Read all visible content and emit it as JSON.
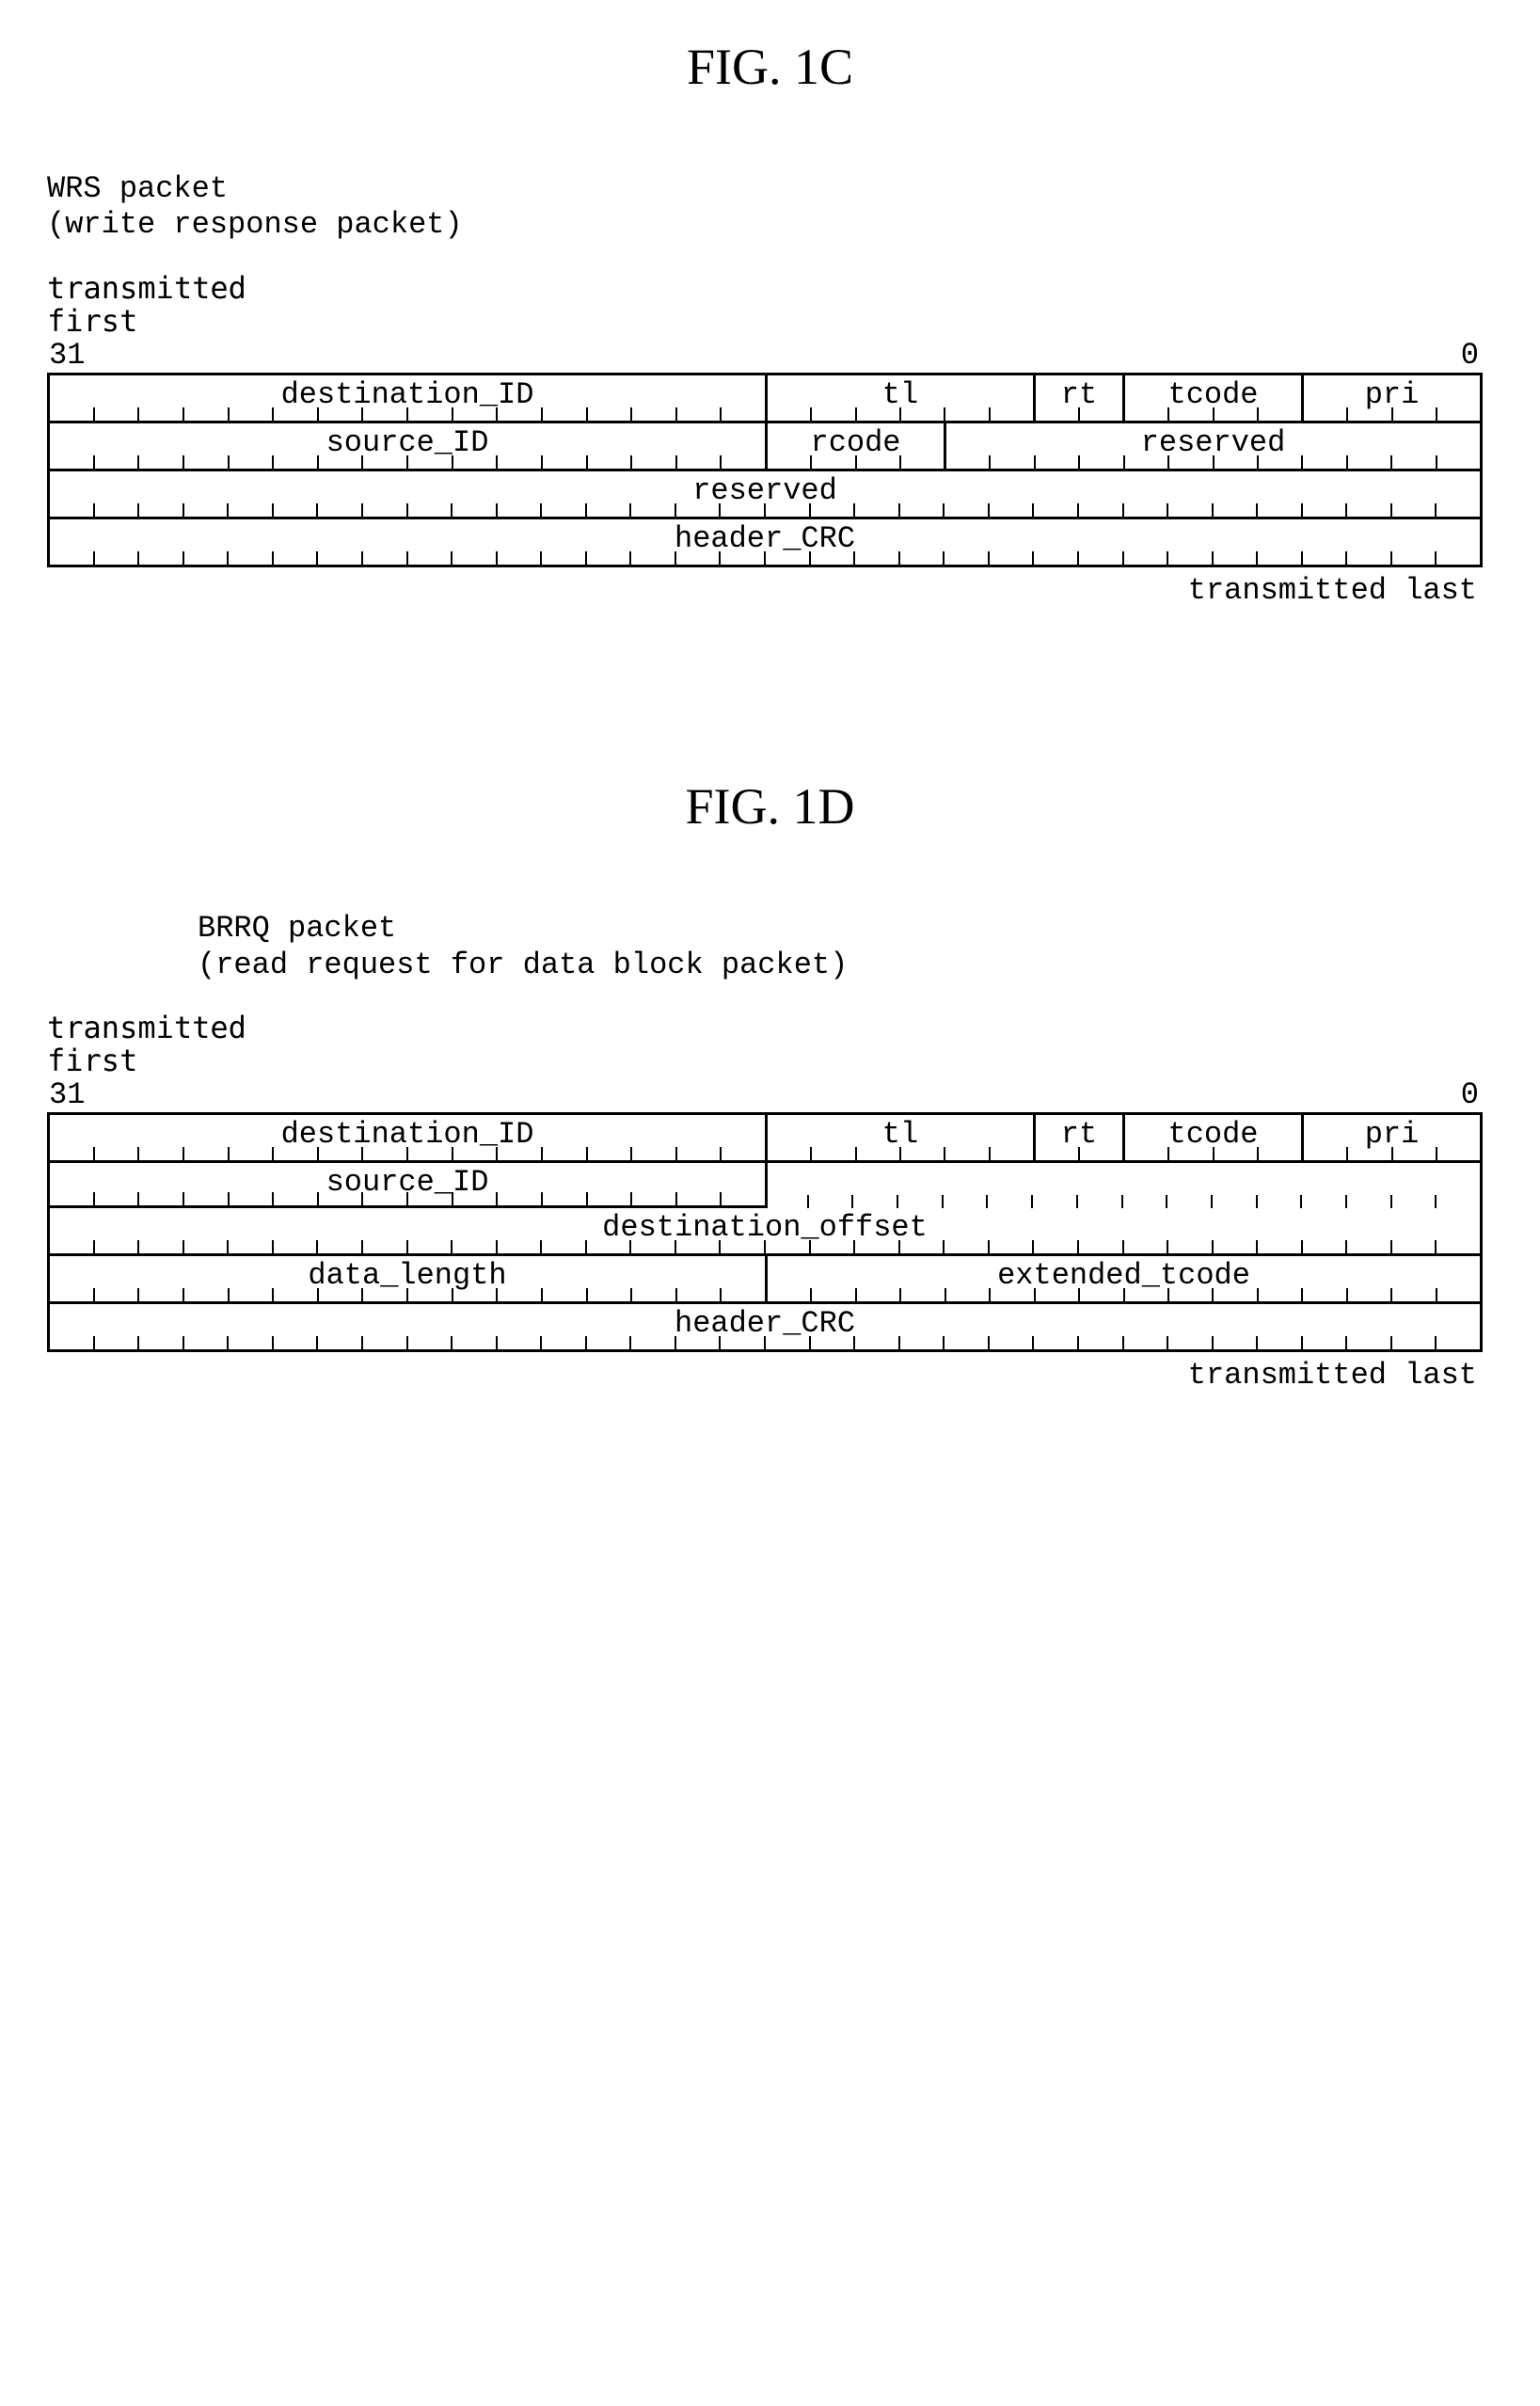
{
  "fig1c": {
    "title": "FIG. 1C",
    "packet_name": "WRS packet",
    "packet_desc": "(write response packet)",
    "tx_first": "transmitted\nfirst",
    "bit_hi": "31",
    "bit_lo": "0",
    "rows": [
      [
        {
          "label": "destination_ID",
          "w": "w16"
        },
        {
          "label": "tl",
          "w": "w6"
        },
        {
          "label": "rt",
          "w": "w2"
        },
        {
          "label": "tcode",
          "w": "w4"
        },
        {
          "label": "pri",
          "w": "w4"
        }
      ],
      [
        {
          "label": "source_ID",
          "w": "w16"
        },
        {
          "label": "rcode",
          "w": "w4"
        },
        {
          "label": "reserved",
          "w": "w12"
        }
      ],
      [
        {
          "label": "reserved",
          "w": "w32"
        }
      ],
      [
        {
          "label": "header_CRC",
          "w": "w32"
        }
      ]
    ],
    "tx_last": "transmitted last"
  },
  "fig1d": {
    "title": "FIG. 1D",
    "packet_name": "BRRQ packet",
    "packet_desc": "(read request for data block packet)",
    "tx_first": "transmitted\nfirst",
    "bit_hi": "31",
    "bit_lo": "0",
    "row1": [
      {
        "label": "destination_ID",
        "w": "w16"
      },
      {
        "label": "tl",
        "w": "w6"
      },
      {
        "label": "rt",
        "w": "w2"
      },
      {
        "label": "tcode",
        "w": "w4"
      },
      {
        "label": "pri",
        "w": "w4"
      }
    ],
    "row2_source": "source_ID",
    "row3_dest_offset": "destination_offset",
    "row4": [
      {
        "label": "data_length",
        "w": "w16"
      },
      {
        "label": "extended_tcode",
        "w": "w16"
      }
    ],
    "row5_header_crc": "header_CRC",
    "tx_last": "transmitted last"
  }
}
